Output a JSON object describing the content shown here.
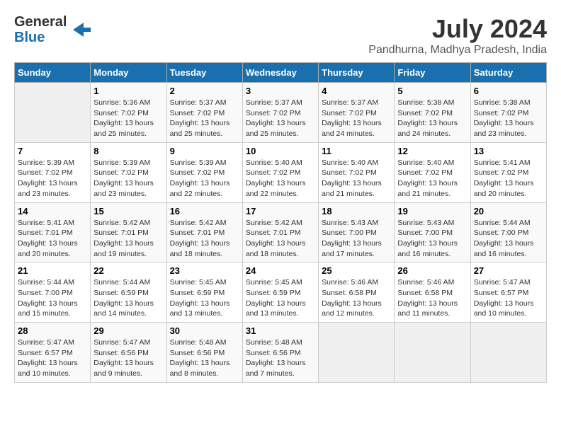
{
  "header": {
    "logo_line1": "General",
    "logo_line2": "Blue",
    "month_year": "July 2024",
    "location": "Pandhurna, Madhya Pradesh, India"
  },
  "columns": [
    "Sunday",
    "Monday",
    "Tuesday",
    "Wednesday",
    "Thursday",
    "Friday",
    "Saturday"
  ],
  "weeks": [
    [
      {
        "day": "",
        "info": ""
      },
      {
        "day": "1",
        "info": "Sunrise: 5:36 AM\nSunset: 7:02 PM\nDaylight: 13 hours\nand 25 minutes."
      },
      {
        "day": "2",
        "info": "Sunrise: 5:37 AM\nSunset: 7:02 PM\nDaylight: 13 hours\nand 25 minutes."
      },
      {
        "day": "3",
        "info": "Sunrise: 5:37 AM\nSunset: 7:02 PM\nDaylight: 13 hours\nand 25 minutes."
      },
      {
        "day": "4",
        "info": "Sunrise: 5:37 AM\nSunset: 7:02 PM\nDaylight: 13 hours\nand 24 minutes."
      },
      {
        "day": "5",
        "info": "Sunrise: 5:38 AM\nSunset: 7:02 PM\nDaylight: 13 hours\nand 24 minutes."
      },
      {
        "day": "6",
        "info": "Sunrise: 5:38 AM\nSunset: 7:02 PM\nDaylight: 13 hours\nand 23 minutes."
      }
    ],
    [
      {
        "day": "7",
        "info": "Sunrise: 5:39 AM\nSunset: 7:02 PM\nDaylight: 13 hours\nand 23 minutes."
      },
      {
        "day": "8",
        "info": "Sunrise: 5:39 AM\nSunset: 7:02 PM\nDaylight: 13 hours\nand 23 minutes."
      },
      {
        "day": "9",
        "info": "Sunrise: 5:39 AM\nSunset: 7:02 PM\nDaylight: 13 hours\nand 22 minutes."
      },
      {
        "day": "10",
        "info": "Sunrise: 5:40 AM\nSunset: 7:02 PM\nDaylight: 13 hours\nand 22 minutes."
      },
      {
        "day": "11",
        "info": "Sunrise: 5:40 AM\nSunset: 7:02 PM\nDaylight: 13 hours\nand 21 minutes."
      },
      {
        "day": "12",
        "info": "Sunrise: 5:40 AM\nSunset: 7:02 PM\nDaylight: 13 hours\nand 21 minutes."
      },
      {
        "day": "13",
        "info": "Sunrise: 5:41 AM\nSunset: 7:02 PM\nDaylight: 13 hours\nand 20 minutes."
      }
    ],
    [
      {
        "day": "14",
        "info": "Sunrise: 5:41 AM\nSunset: 7:01 PM\nDaylight: 13 hours\nand 20 minutes."
      },
      {
        "day": "15",
        "info": "Sunrise: 5:42 AM\nSunset: 7:01 PM\nDaylight: 13 hours\nand 19 minutes."
      },
      {
        "day": "16",
        "info": "Sunrise: 5:42 AM\nSunset: 7:01 PM\nDaylight: 13 hours\nand 18 minutes."
      },
      {
        "day": "17",
        "info": "Sunrise: 5:42 AM\nSunset: 7:01 PM\nDaylight: 13 hours\nand 18 minutes."
      },
      {
        "day": "18",
        "info": "Sunrise: 5:43 AM\nSunset: 7:00 PM\nDaylight: 13 hours\nand 17 minutes."
      },
      {
        "day": "19",
        "info": "Sunrise: 5:43 AM\nSunset: 7:00 PM\nDaylight: 13 hours\nand 16 minutes."
      },
      {
        "day": "20",
        "info": "Sunrise: 5:44 AM\nSunset: 7:00 PM\nDaylight: 13 hours\nand 16 minutes."
      }
    ],
    [
      {
        "day": "21",
        "info": "Sunrise: 5:44 AM\nSunset: 7:00 PM\nDaylight: 13 hours\nand 15 minutes."
      },
      {
        "day": "22",
        "info": "Sunrise: 5:44 AM\nSunset: 6:59 PM\nDaylight: 13 hours\nand 14 minutes."
      },
      {
        "day": "23",
        "info": "Sunrise: 5:45 AM\nSunset: 6:59 PM\nDaylight: 13 hours\nand 13 minutes."
      },
      {
        "day": "24",
        "info": "Sunrise: 5:45 AM\nSunset: 6:59 PM\nDaylight: 13 hours\nand 13 minutes."
      },
      {
        "day": "25",
        "info": "Sunrise: 5:46 AM\nSunset: 6:58 PM\nDaylight: 13 hours\nand 12 minutes."
      },
      {
        "day": "26",
        "info": "Sunrise: 5:46 AM\nSunset: 6:58 PM\nDaylight: 13 hours\nand 11 minutes."
      },
      {
        "day": "27",
        "info": "Sunrise: 5:47 AM\nSunset: 6:57 PM\nDaylight: 13 hours\nand 10 minutes."
      }
    ],
    [
      {
        "day": "28",
        "info": "Sunrise: 5:47 AM\nSunset: 6:57 PM\nDaylight: 13 hours\nand 10 minutes."
      },
      {
        "day": "29",
        "info": "Sunrise: 5:47 AM\nSunset: 6:56 PM\nDaylight: 13 hours\nand 9 minutes."
      },
      {
        "day": "30",
        "info": "Sunrise: 5:48 AM\nSunset: 6:56 PM\nDaylight: 13 hours\nand 8 minutes."
      },
      {
        "day": "31",
        "info": "Sunrise: 5:48 AM\nSunset: 6:56 PM\nDaylight: 13 hours\nand 7 minutes."
      },
      {
        "day": "",
        "info": ""
      },
      {
        "day": "",
        "info": ""
      },
      {
        "day": "",
        "info": ""
      }
    ]
  ]
}
